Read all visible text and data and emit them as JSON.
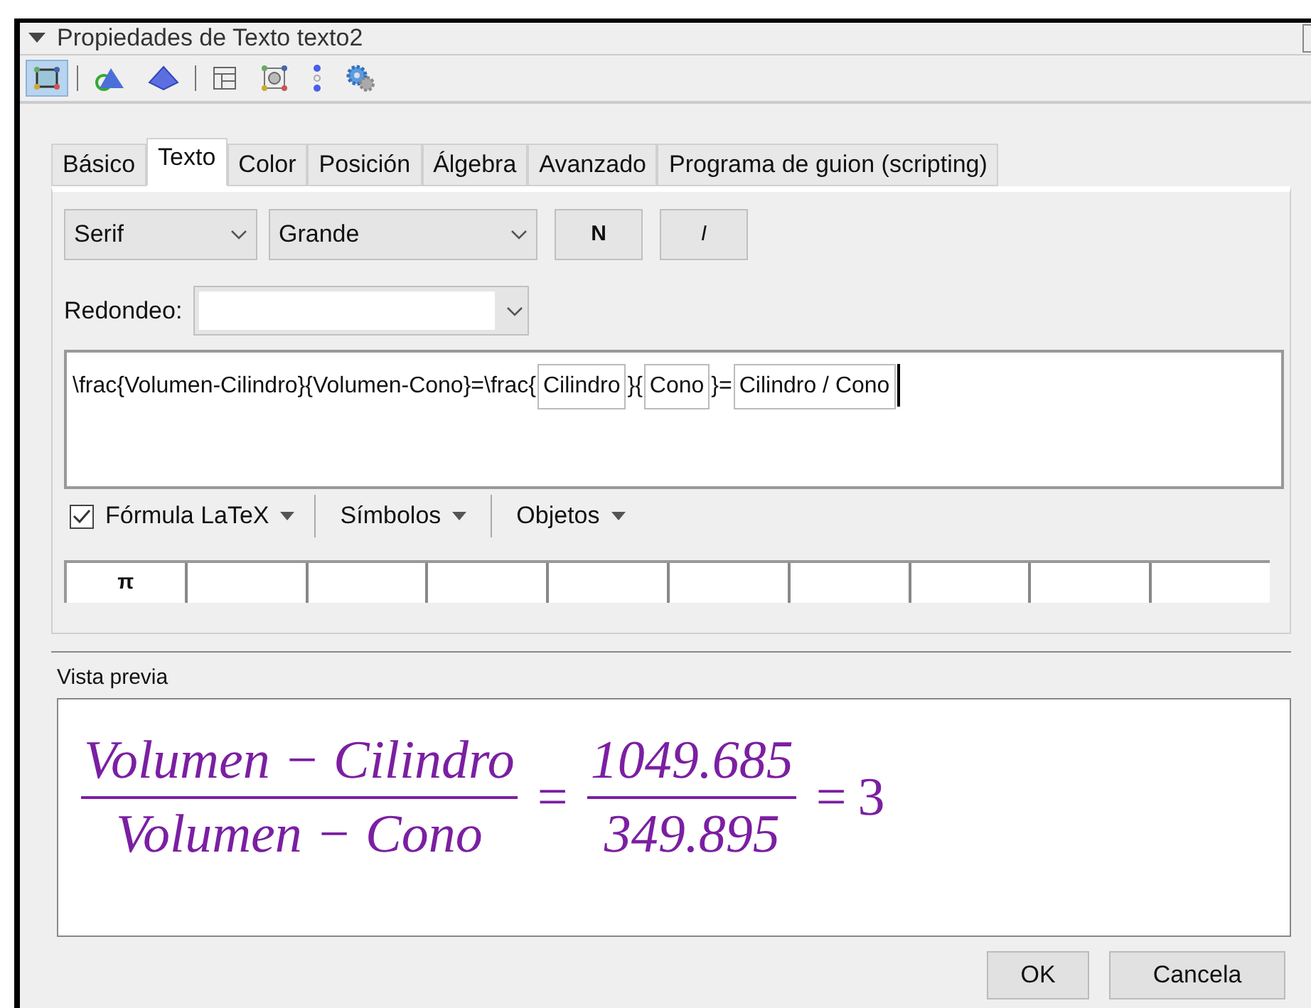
{
  "window": {
    "title": "Propiedades de Texto texto2"
  },
  "toolbar_groups": [
    [
      {
        "selected": true
      }
    ],
    [
      {
        "selected": false
      },
      {
        "selected": false
      }
    ],
    [
      {
        "selected": false
      },
      {
        "selected": false
      },
      {
        "selected": false
      },
      {
        "selected": false
      }
    ]
  ],
  "tabs": [
    {
      "label": "Básico",
      "selected": false
    },
    {
      "label": "Texto",
      "selected": true
    },
    {
      "label": "Color",
      "selected": false
    },
    {
      "label": "Posición",
      "selected": false
    },
    {
      "label": "Álgebra",
      "selected": false
    },
    {
      "label": "Avanzado",
      "selected": false
    },
    {
      "label": "Programa de guion (scripting)",
      "selected": false
    }
  ],
  "font_dropdown": {
    "value": "Serif"
  },
  "size_dropdown": {
    "value": "Grande"
  },
  "style_buttons": [
    {
      "label": "N",
      "kind": "bold"
    },
    {
      "label": "I",
      "kind": "italic"
    }
  ],
  "rounding": {
    "label": "Redondeo:"
  },
  "editor": {
    "segments": [
      {
        "kind": "text",
        "text": "\\frac{Volumen-Cilindro}{Volumen-Cono}=\\frac{"
      },
      {
        "kind": "object",
        "text": "Cilindro"
      },
      {
        "kind": "text",
        "text": "}{"
      },
      {
        "kind": "object",
        "text": "Cono"
      },
      {
        "kind": "text",
        "text": "}="
      },
      {
        "kind": "object",
        "text": "Cilindro / Cono"
      }
    ]
  },
  "latex": {
    "label": "Fórmula LaTeX",
    "checked": true
  },
  "menus": [
    "Símbolos",
    "Objetos"
  ],
  "symbol_cells": [
    "π"
  ],
  "preview": {
    "label": "Vista previa",
    "items": [
      {
        "kind": "fraction",
        "numerator": "Volumen − Cilindro",
        "denominator": "Volumen − Cono"
      },
      {
        "kind": "operator",
        "text": "="
      },
      {
        "kind": "fraction",
        "numerator": "1049.685",
        "denominator": "349.895"
      },
      {
        "kind": "operator",
        "text": "="
      },
      {
        "kind": "number",
        "text": "3"
      }
    ]
  },
  "buttons": [
    "OK",
    "Cancela"
  ]
}
